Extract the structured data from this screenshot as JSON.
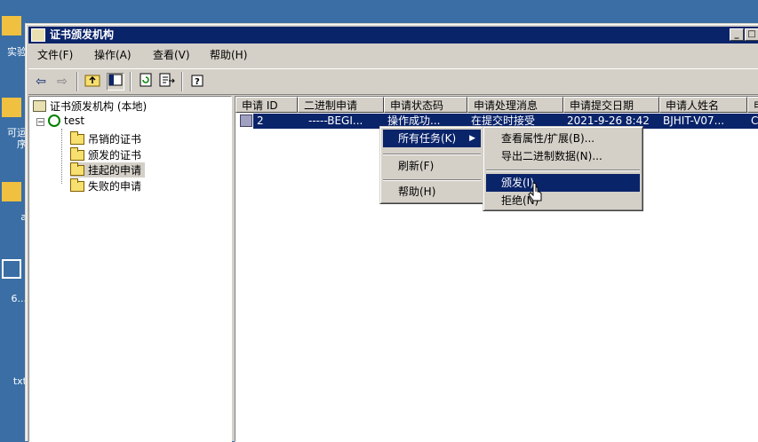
{
  "desktop": {
    "items": [
      {
        "label": "实验",
        "icon": "folder-icon"
      },
      {
        "label": "可运\n序",
        "icon": "folder-icon"
      },
      {
        "label": "а",
        "icon": "folder-icon"
      },
      {
        "label": "6...",
        "icon": "computer-icon"
      },
      {
        "label": "txt",
        "icon": "text-file-icon"
      }
    ]
  },
  "window": {
    "title": "证书颁发机构",
    "min_label": "_",
    "max_label": "□"
  },
  "menubar": {
    "items": [
      "文件(F)",
      "操作(A)",
      "查看(V)",
      "帮助(H)"
    ]
  },
  "toolbar": {
    "buttons": [
      "back-icon",
      "forward-icon",
      "up-folder-icon",
      "show-tree-icon",
      "refresh-icon",
      "export-icon",
      "help-icon"
    ]
  },
  "tree": {
    "root": "证书颁发机构 (本地)",
    "ca": "test",
    "children": [
      "吊销的证书",
      "颁发的证书",
      "挂起的申请",
      "失败的申请"
    ],
    "selected_index": 2
  },
  "list": {
    "columns": [
      "申请 ID",
      "二进制申请",
      "申请状态码",
      "申请处理消息",
      "申请提交日期",
      "申请人姓名",
      "申"
    ],
    "row": [
      "2",
      "-----BEGI...",
      "操作成功...",
      "在提交时接受",
      "2021-9-26 8:42",
      "BJHIT-V07...",
      "C"
    ]
  },
  "context_menu": {
    "items": [
      "所有任务(K)",
      "刷新(F)",
      "帮助(H)"
    ],
    "highlighted_index": 0
  },
  "submenu": {
    "items": [
      "查看属性/扩展(B)...",
      "导出二进制数据(N)...",
      "颁发(I)",
      "拒绝(N)"
    ],
    "highlighted_index": 2
  }
}
